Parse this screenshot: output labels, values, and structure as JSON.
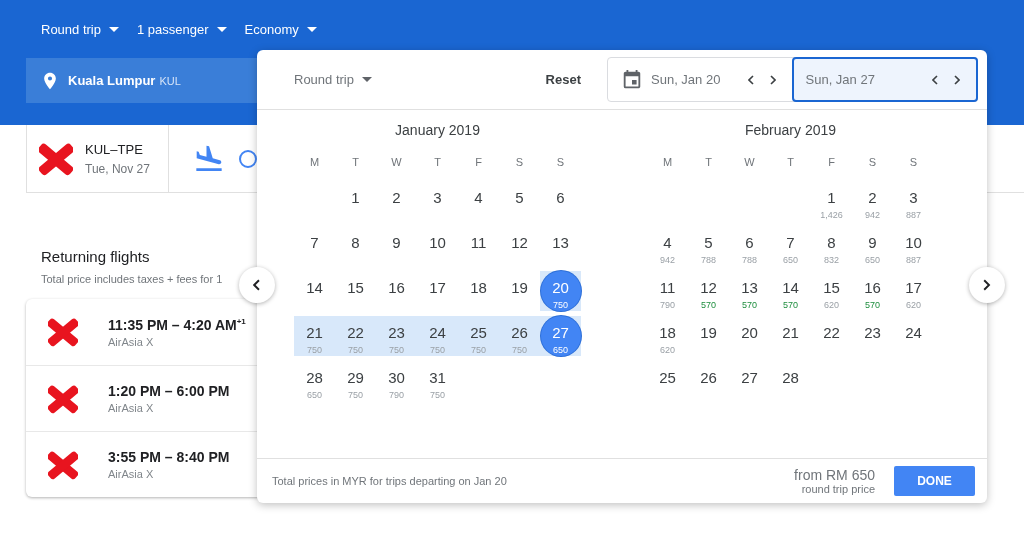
{
  "top_bar": {
    "options": [
      {
        "label": "Round trip"
      },
      {
        "label": "1 passenger"
      },
      {
        "label": "Economy"
      }
    ]
  },
  "origin": {
    "city": "Kuala Lumpur",
    "code": "KUL"
  },
  "summary": {
    "route": "KUL–TPE",
    "date": "Tue, Nov 27"
  },
  "returning": {
    "title": "Returning flights",
    "subtitle": "Total price includes taxes + fees for 1",
    "flights": [
      {
        "times": "11:35 PM – 4:20 AM$^{+1}$",
        "airline": "AirAsia X"
      },
      {
        "times": "1:20 PM – 6:00 PM",
        "airline": "AirAsia X"
      },
      {
        "times": "3:55 PM – 8:40 PM",
        "airline": "AirAsia X"
      }
    ]
  },
  "date_picker": {
    "trip_type": "Round trip",
    "reset": "Reset",
    "dates": [
      {
        "value": "Sun, Jan 20",
        "selected": false
      },
      {
        "value": "Sun, Jan 27",
        "selected": true
      }
    ],
    "months": [
      {
        "title": "January 2019",
        "weekdays": [
          "M",
          "T",
          "W",
          "T",
          "F",
          "S",
          "S"
        ],
        "weeks": [
          [
            {
              "day": "1",
              "selected": false,
              "in_range": false
            },
            {
              "day": "2",
              "selected": false,
              "in_range": false
            },
            {
              "day": "3",
              "selected": false,
              "in_range": false
            },
            {
              "day": "4",
              "selected": false,
              "in_range": false
            },
            {
              "day": "5",
              "selected": false,
              "in_range": false
            },
            {
              "day": "6",
              "selected": false,
              "in_range": false
            }
          ],
          [
            {
              "day": "7",
              "selected": false,
              "in_range": false
            },
            {
              "day": "8",
              "selected": false,
              "in_range": false
            },
            {
              "day": "9",
              "selected": false,
              "in_range": false
            },
            {
              "day": "10",
              "selected": false,
              "in_range": false
            },
            {
              "day": "11",
              "selected": false,
              "in_range": false
            },
            {
              "day": "12",
              "selected": false,
              "in_range": false
            },
            {
              "day": "13",
              "selected": false,
              "in_range": false
            }
          ],
          [
            {
              "day": "14",
              "selected": false,
              "in_range": false
            },
            {
              "day": "15",
              "selected": false,
              "in_range": false
            },
            {
              "day": "16",
              "selected": false,
              "in_range": false
            },
            {
              "day": "17",
              "selected": false,
              "in_range": false
            },
            {
              "day": "18",
              "selected": false,
              "in_range": false
            },
            {
              "day": "19",
              "selected": false,
              "in_range": false
            },
            {
              "day": "20",
              "price": "750",
              "selected": true,
              "in_range": true
            }
          ],
          [
            {
              "day": "21",
              "price": "750",
              "selected": false,
              "in_range": true,
              "cheapest": false
            },
            {
              "day": "22",
              "price": "750",
              "selected": false,
              "in_range": true,
              "cheapest": false
            },
            {
              "day": "23",
              "price": "750",
              "selected": false,
              "in_range": true,
              "cheapest": false
            },
            {
              "day": "24",
              "price": "750",
              "selected": false,
              "in_range": true,
              "cheapest": false
            },
            {
              "day": "25",
              "price": "750",
              "selected": false,
              "in_range": true,
              "cheapest": false
            },
            {
              "day": "26",
              "price": "750",
              "selected": false,
              "in_range": true,
              "cheapest": false
            },
            {
              "day": "27",
              "price": "650",
              "selected": true,
              "in_range": true
            }
          ],
          [
            {
              "day": "28",
              "price": "650",
              "selected": false,
              "in_range": false,
              "cheapest": false
            },
            {
              "day": "29",
              "price": "750",
              "selected": false,
              "in_range": false,
              "cheapest": false
            },
            {
              "day": "30",
              "price": "790",
              "selected": false,
              "in_range": false,
              "cheapest": false
            },
            {
              "day": "31",
              "price": "750",
              "selected": false,
              "in_range": false,
              "cheapest": false
            }
          ]
        ]
      },
      {
        "title": "February 2019",
        "weekdays": [
          "M",
          "T",
          "W",
          "T",
          "F",
          "S",
          "S"
        ],
        "weeks": [
          [
            {
              "day": "1",
              "price": "1,426",
              "selected": false,
              "in_range": false,
              "cheapest": false
            },
            {
              "day": "2",
              "price": "942",
              "selected": false,
              "in_range": false,
              "cheapest": false
            },
            {
              "day": "3",
              "price": "887",
              "selected": false,
              "in_range": false,
              "cheapest": false
            }
          ],
          [
            {
              "day": "4",
              "price": "942",
              "selected": false,
              "in_range": false,
              "cheapest": false
            },
            {
              "day": "5",
              "price": "788",
              "selected": false,
              "in_range": false,
              "cheapest": false
            },
            {
              "day": "6",
              "price": "788",
              "selected": false,
              "in_range": false,
              "cheapest": false
            },
            {
              "day": "7",
              "price": "650",
              "selected": false,
              "in_range": false,
              "cheapest": false
            },
            {
              "day": "8",
              "price": "832",
              "selected": false,
              "in_range": false,
              "cheapest": false
            },
            {
              "day": "9",
              "price": "650",
              "selected": false,
              "in_range": false,
              "cheapest": false
            },
            {
              "day": "10",
              "price": "887",
              "selected": false,
              "in_range": false,
              "cheapest": false
            }
          ],
          [
            {
              "day": "11",
              "price": "790",
              "selected": false,
              "in_range": false,
              "cheapest": false
            },
            {
              "day": "12",
              "price": "570",
              "selected": false,
              "in_range": false,
              "cheapest": true
            },
            {
              "day": "13",
              "price": "570",
              "selected": false,
              "in_range": false,
              "cheapest": true
            },
            {
              "day": "14",
              "price": "570",
              "selected": false,
              "in_range": false,
              "cheapest": true
            },
            {
              "day": "15",
              "price": "620",
              "selected": false,
              "in_range": false,
              "cheapest": false
            },
            {
              "day": "16",
              "price": "570",
              "selected": false,
              "in_range": false,
              "cheapest": true
            },
            {
              "day": "17",
              "price": "620",
              "selected": false,
              "in_range": false,
              "cheapest": false
            }
          ],
          [
            {
              "day": "18",
              "price": "620",
              "selected": false,
              "in_range": false,
              "cheapest": false
            },
            {
              "day": "19",
              "selected": false,
              "in_range": false
            },
            {
              "day": "20",
              "selected": false,
              "in_range": false
            },
            {
              "day": "21",
              "selected": false,
              "in_range": false
            },
            {
              "day": "22",
              "selected": false,
              "in_range": false
            },
            {
              "day": "23",
              "selected": false,
              "in_range": false
            },
            {
              "day": "24",
              "selected": false,
              "in_range": false
            }
          ],
          [
            {
              "day": "25",
              "selected": false,
              "in_range": false
            },
            {
              "day": "26",
              "selected": false,
              "in_range": false
            },
            {
              "day": "27",
              "selected": false,
              "in_range": false
            },
            {
              "day": "28",
              "selected": false,
              "in_range": false
            }
          ]
        ]
      }
    ],
    "footer": {
      "note": "Total prices in MYR for trips departing on Jan 20",
      "price": "from RM 650",
      "price_caption": "round trip price",
      "done": "DONE"
    }
  }
}
